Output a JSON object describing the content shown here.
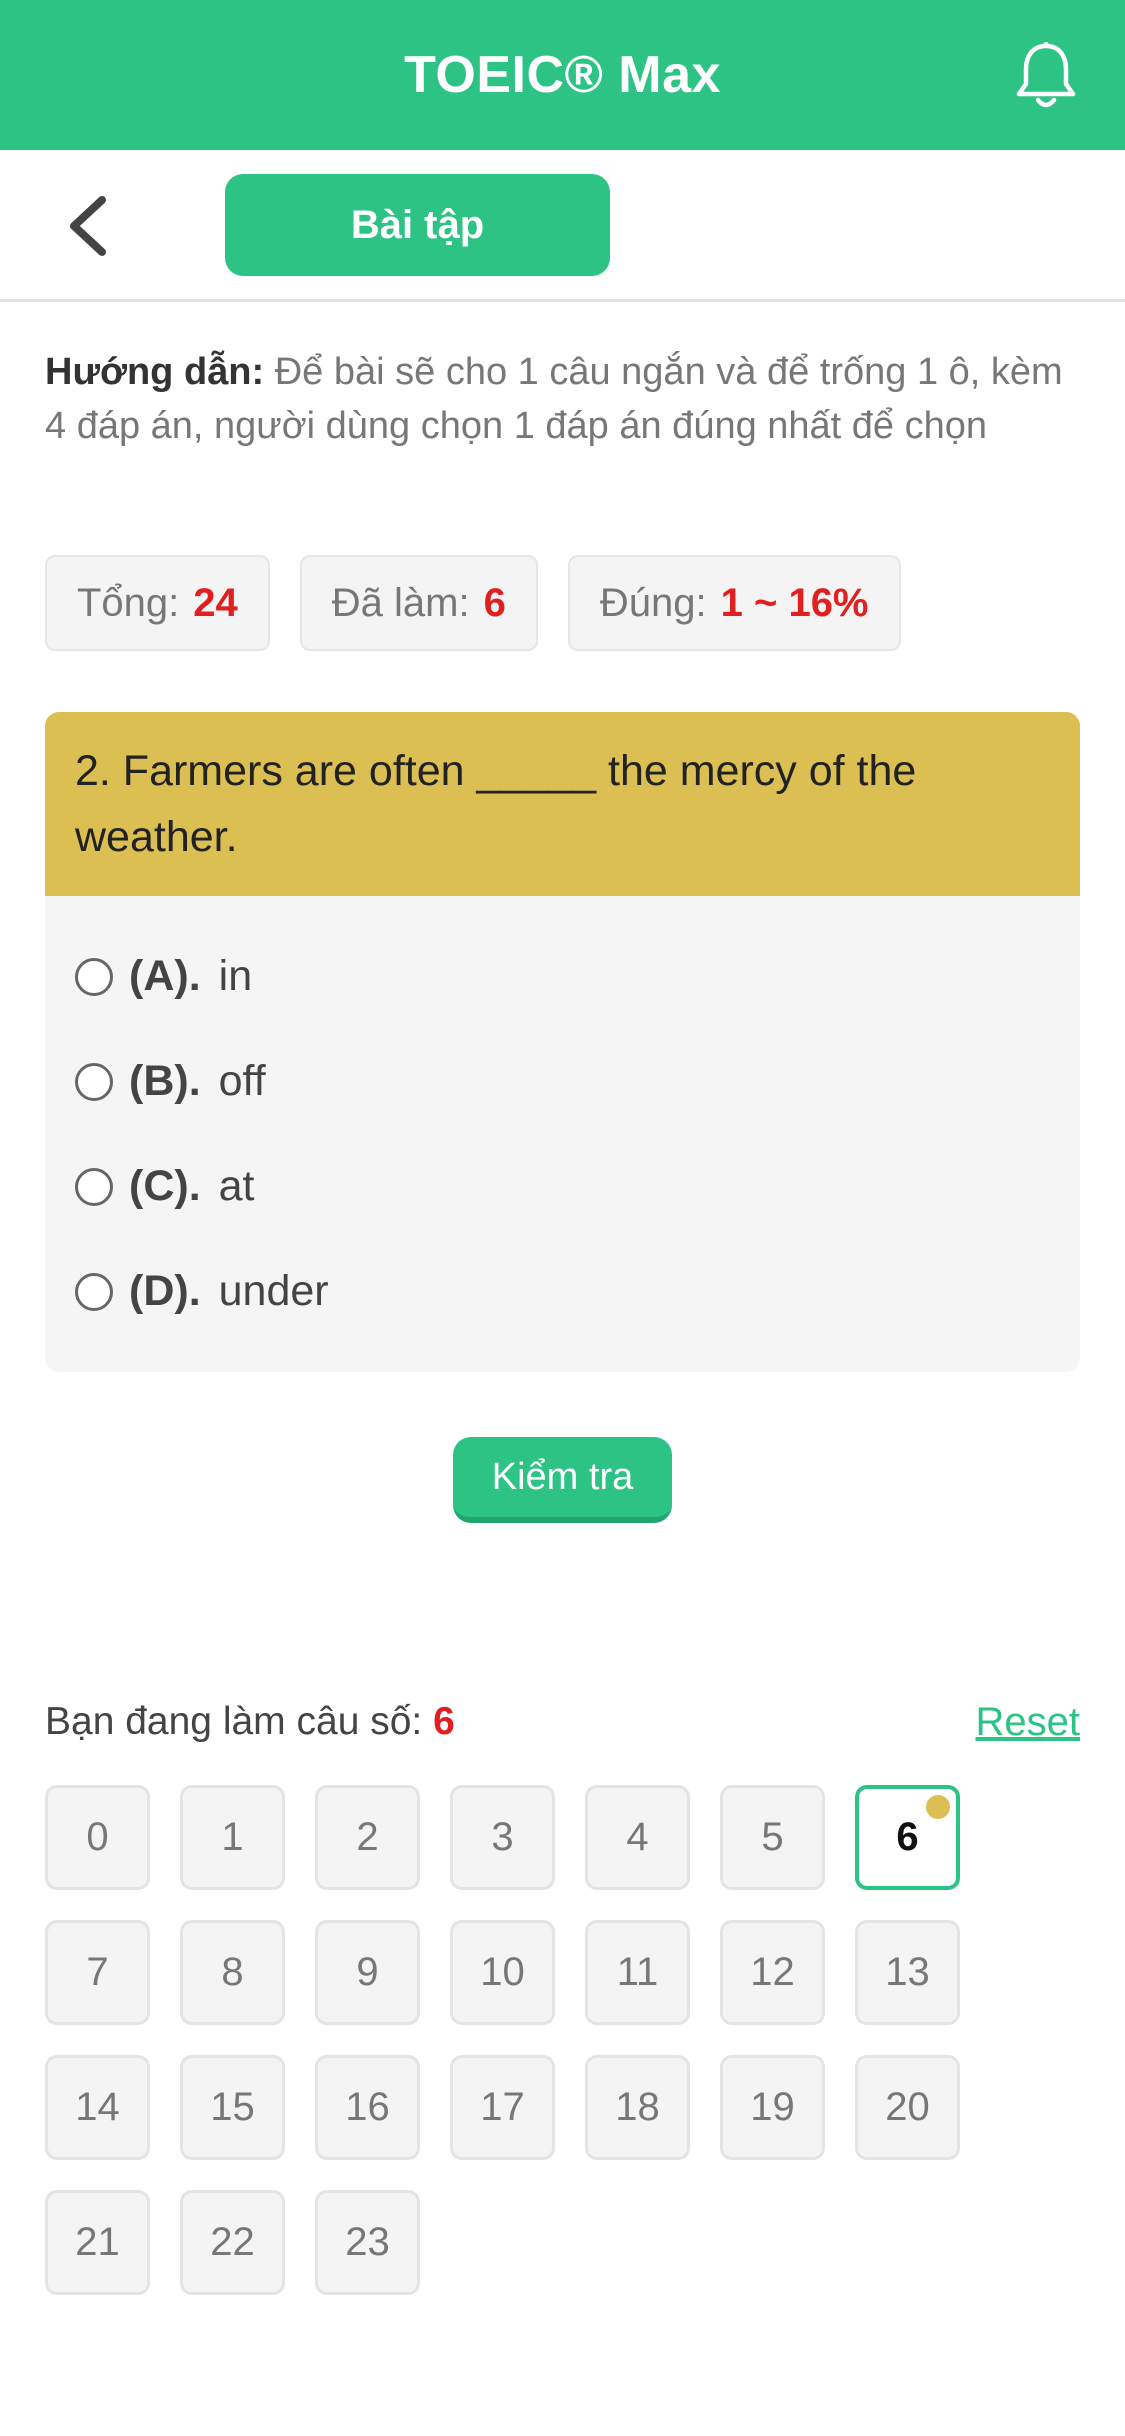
{
  "header": {
    "title": "TOEIC® Max",
    "bell_icon": "bell-icon"
  },
  "subbar": {
    "back_icon": "chevron-left-icon",
    "tab_label": "Bài tập"
  },
  "instruction": {
    "label": "Hướng dẫn:",
    "text": "Để bài sẽ cho 1 câu ngắn và để trống 1 ô, kèm 4 đáp án, người dùng chọn 1 đáp án đúng nhất để chọn"
  },
  "stats": {
    "total_label": "Tổng:",
    "total_value": "24",
    "done_label": "Đã làm:",
    "done_value": "6",
    "correct_label": "Đúng:",
    "correct_value": "1 ~ 16%"
  },
  "question": {
    "text": "2. Farmers are often _____ the mercy of the weather.",
    "options": [
      {
        "key": "(A).",
        "text": "in"
      },
      {
        "key": "(B).",
        "text": "off"
      },
      {
        "key": "(C).",
        "text": "at"
      },
      {
        "key": "(D).",
        "text": "under"
      }
    ]
  },
  "check_button": "Kiểm tra",
  "navigator": {
    "current_label": "Bạn đang làm câu số:",
    "current_value": "6",
    "reset_label": "Reset",
    "numbers": [
      "0",
      "1",
      "2",
      "3",
      "4",
      "5",
      "6",
      "7",
      "8",
      "9",
      "10",
      "11",
      "12",
      "13",
      "14",
      "15",
      "16",
      "17",
      "18",
      "19",
      "20",
      "21",
      "22",
      "23"
    ],
    "active": "6",
    "marker_color": "#dcbf52"
  },
  "colors": {
    "brand": "#2dc385",
    "question_bg": "#dcbf52",
    "highlight": "#e02020"
  }
}
